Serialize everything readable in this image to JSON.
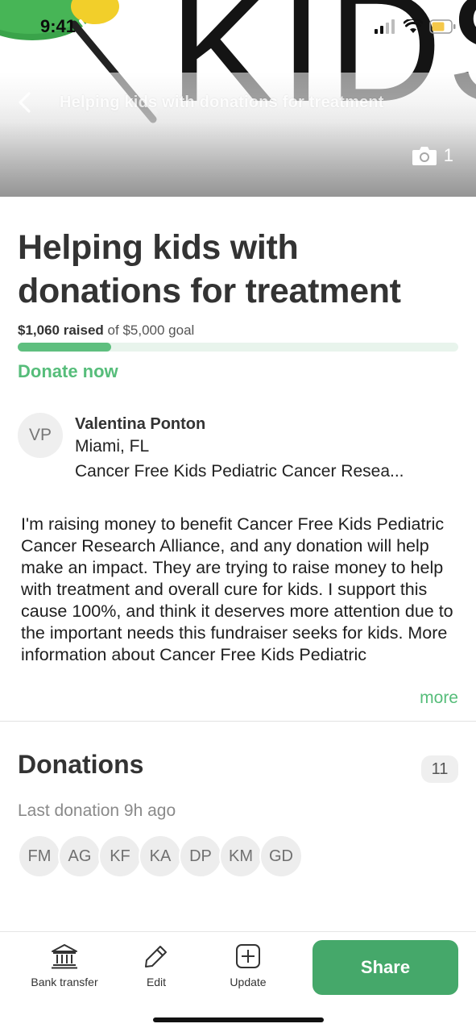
{
  "status_bar": {
    "time": "9:41",
    "icons": [
      "signal-icon",
      "wifi-icon",
      "battery-icon"
    ]
  },
  "hero": {
    "image_text": "KIDS",
    "nav_title": "Helping kids with donations for treatment",
    "photo_count": "1"
  },
  "campaign": {
    "title": "Helping kids with donations for treatment",
    "raised_amount": "$1,060 raised",
    "goal_text": "of $5,000 goal",
    "progress_fraction": 0.212,
    "donate_label": "Donate now"
  },
  "organizer": {
    "initials": "VP",
    "name": "Valentina Ponton",
    "location": "Miami, FL",
    "cause": "Cancer Free Kids Pediatric Cancer Resea..."
  },
  "story": {
    "text": "I'm raising money to benefit Cancer Free Kids Pediatric Cancer Research Alliance, and any donation will help make an impact. They are trying to raise money to help with treatment and overall cure for kids. I support this cause 100%, and think it deserves more attention due to the important needs this fundraiser seeks for kids. More information about Cancer Free Kids Pediatric",
    "more_label": "more"
  },
  "donations": {
    "title": "Donations",
    "count": "11",
    "last_donation": "Last donation 9h ago",
    "donors": [
      "FM",
      "AG",
      "KF",
      "KA",
      "DP",
      "KM",
      "GD"
    ]
  },
  "toolbar": {
    "bank_transfer_label": "Bank transfer",
    "edit_label": "Edit",
    "update_label": "Update",
    "share_label": "Share"
  },
  "colors": {
    "accent_green": "#56bd7a",
    "share_button": "#45a86a",
    "progress_track": "#e8f4ec"
  }
}
